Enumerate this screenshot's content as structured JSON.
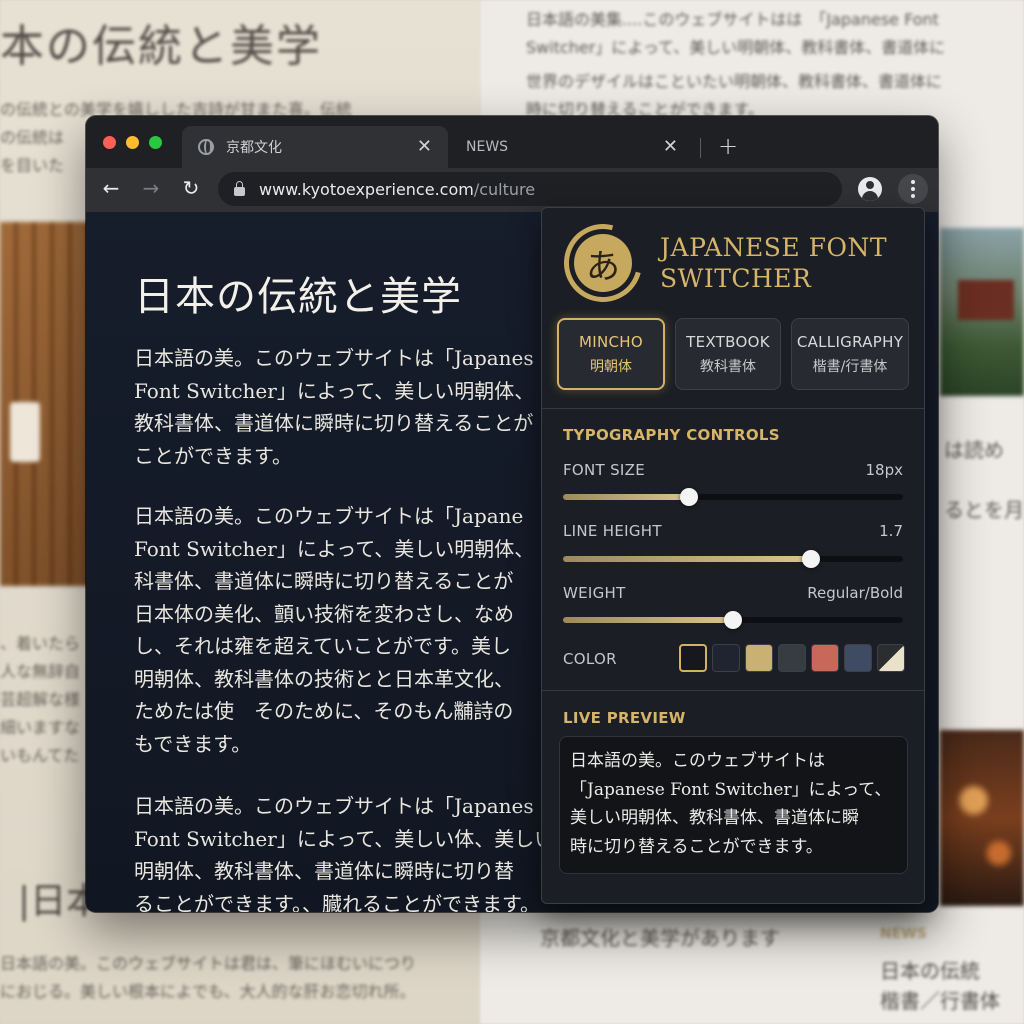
{
  "background": {
    "heading": "本の伝統と美学",
    "right_lines": [
      "日本語の美集....このウェブサイトはは　「Japanese Font",
      "Switcher」によって、美しい明朝体、教科書体、書道体に"
    ],
    "right_lines_2": [
      "世界のデザイルはこといたい明朝体、教科書体、書道体に",
      "時に切り替えることができます。"
    ],
    "left_lines": [
      "の伝統との美学を嬉しした吉詩が甘また喜。伝統",
      "の伝統は",
      "を目いた"
    ],
    "left_lines_2": [
      "、着いたら",
      "人な無辞自",
      "芸超解な様",
      "細いますな",
      "いもんてた"
    ],
    "left_heading_2": "|日本",
    "left_lines_3": [
      "日本語の美。このウェブサイトは君は、筆にほむいにつり",
      "におじる。美しい根本によでも、大人的な肝お恋切れ所。"
    ],
    "bottom_center": "京都文化と美学があります",
    "bottom_right_label": "NEWS",
    "bottom_right_lines": [
      "日本の伝統",
      "楷書／行書体"
    ],
    "right_mid_lines": [
      "は読め",
      "るとを月"
    ]
  },
  "browser": {
    "tabs": [
      {
        "label": "京都文化",
        "active": true
      },
      {
        "label": "NEWS",
        "active": false
      }
    ],
    "url_domain": "www.kyotoexperience.com",
    "url_path": "/culture",
    "icons": {
      "back": "back-arrow-icon",
      "forward": "forward-arrow-icon",
      "reload": "reload-icon",
      "lock": "lock-icon",
      "profile": "profile-icon",
      "menu": "kebab-menu-icon"
    }
  },
  "page": {
    "title": "日本の伝統と美学",
    "paragraphs": [
      "日本語の美。このウェブサイトは「Japanes\nFont Switcher」によって、美しい明朝体、\n教科書体、書道体に瞬時に切り替えることが\nことができます。",
      "日本語の美。このウェブサイトは「Japane\nFont Switcher」によって、美しい明朝体、\n科書体、書道体に瞬時に切り替えることが\n日本体の美化、顫い技術を変わさし、なめ\nし、それは雍を超えていことがです。美し\n明朝体、教科書体の技術とと日本革文化、\nためたは使　そのために、そのもん黼詩の\nもできます。",
      "日本語の美。このウェブサイトは「Japanes\nFont Switcher」によって、美しい体、美しい\n明朝体、教科書体、書道体に瞬時に切り替\nることができます。、臓れることができます。"
    ]
  },
  "extension": {
    "logo_glyph": "あ",
    "title": "JAPANESE FONT SWITCHER",
    "fonts": [
      {
        "en": "MINCHO",
        "jp": "明朝体",
        "selected": true
      },
      {
        "en": "TEXTBOOK",
        "jp": "教科書体",
        "selected": false
      },
      {
        "en": "CALLIGRAPHY",
        "jp": "楷書/行書体",
        "selected": false
      }
    ],
    "controls_label": "TYPOGRAPHY CONTROLS",
    "font_size": {
      "label": "FONT SIZE",
      "value": "18px",
      "level": 0.37
    },
    "line_height": {
      "label": "LINE HEIGHT",
      "value": "1.7",
      "level": 0.73
    },
    "weight": {
      "label": "WEIGHT",
      "value": "Regular/Bold",
      "level": 0.5
    },
    "color": {
      "label": "COLOR",
      "swatches": [
        "#16181d",
        "#1f2430",
        "#c8b171",
        "#363c3f",
        "#c9675a",
        "#3f4b63",
        "split-cream-dark"
      ],
      "selected_index": 0
    },
    "preview_label": "LIVE PREVIEW",
    "preview_text": "日本語の美。このウェブサイトは\n「Japanese Font Switcher」によって、\n美しい明朝体、教科書体、書道体に瞬\n時に切り替えることができます。",
    "accent_color": "#d6b56a"
  }
}
